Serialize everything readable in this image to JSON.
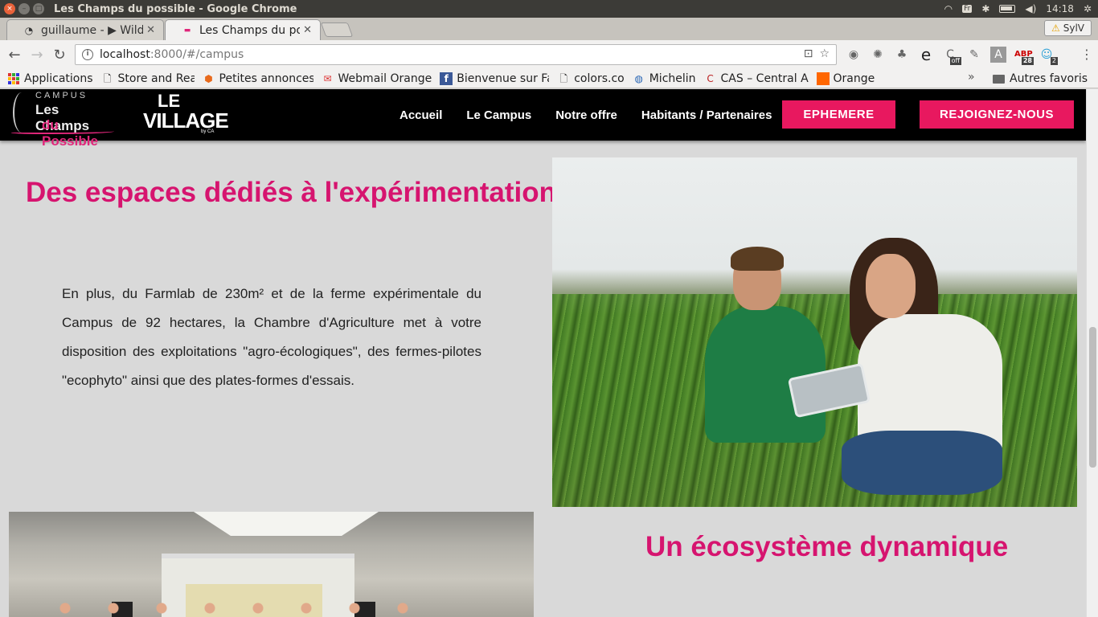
{
  "window": {
    "title": "Les Champs du possible - Google Chrome",
    "tray": {
      "lang": "Fr",
      "time": "14:18"
    }
  },
  "tabs": [
    {
      "label": "guillaume - ▶ Wild Ch",
      "icon": "loading-icon"
    },
    {
      "label": "Les Champs du possible",
      "icon": "site-favicon",
      "active": true
    }
  ],
  "profile": {
    "name": "SylV"
  },
  "omnibox": {
    "host": "localhost",
    "path": ":8000/#/campus"
  },
  "extensions": [
    {
      "name": "ext-circle-icon",
      "glyph": "◉"
    },
    {
      "name": "ext-puzzle-icon",
      "glyph": "✺"
    },
    {
      "name": "ext-tree-icon",
      "glyph": "♣"
    },
    {
      "name": "ext-e-icon",
      "glyph": "e"
    },
    {
      "name": "ext-c-off-icon",
      "glyph": "C",
      "count": "off"
    },
    {
      "name": "eyedropper-icon",
      "glyph": "✎"
    },
    {
      "name": "ext-a-icon",
      "glyph": "A"
    },
    {
      "name": "adblock-icon",
      "glyph": "ABP",
      "count": "28"
    },
    {
      "name": "ext-ghost-icon",
      "glyph": "☺",
      "count": "2"
    }
  ],
  "bookmarks": [
    {
      "label": "Applications",
      "icon": "apps-grid-icon"
    },
    {
      "label": "Store and Read In",
      "icon": "page-icon"
    },
    {
      "label": "Petites annonces",
      "icon": "box-icon"
    },
    {
      "label": "Webmail Orange",
      "icon": "webmail-icon"
    },
    {
      "label": "Bienvenue sur Fa",
      "icon": "facebook-icon"
    },
    {
      "label": "colors.co",
      "icon": "page-icon"
    },
    {
      "label": "Michelin",
      "icon": "michelin-icon"
    },
    {
      "label": "CAS – Central Aut",
      "icon": "cas-icon"
    },
    {
      "label": "Orange",
      "icon": "orange-icon"
    }
  ],
  "bookmarks_more": "»",
  "other_bookmarks": "Autres favoris",
  "site": {
    "logo_campus": {
      "top": "CAMPUS",
      "line1": "Les Champs",
      "line2": "du Possible"
    },
    "logo_village": {
      "le": "LE",
      "village": "VILLAGE",
      "by": "by CA"
    },
    "nav": [
      "Accueil",
      "Le Campus",
      "Notre offre",
      "Habitants / Partenaires"
    ],
    "cta_ephemere": "EPHEMERE",
    "cta_join": "REJOIGNEZ-NOUS",
    "section1_title": "Des espaces dédiés à l'expérimentation",
    "section1_body": "En plus, du Farmlab de 230m² et de la ferme expérimentale du Campus de 92 hectares, la Chambre d'Agriculture met à votre disposition des exploitations \"agro-écologiques\", des fermes-pilotes \"ecophyto\" ainsi que des plates-formes d'essais.",
    "section2_title": "Un écosystème dynamique"
  },
  "colors": {
    "accent": "#e8185f",
    "title": "#d6146f",
    "header": "#000000",
    "page_bg": "#d9d9d9"
  }
}
